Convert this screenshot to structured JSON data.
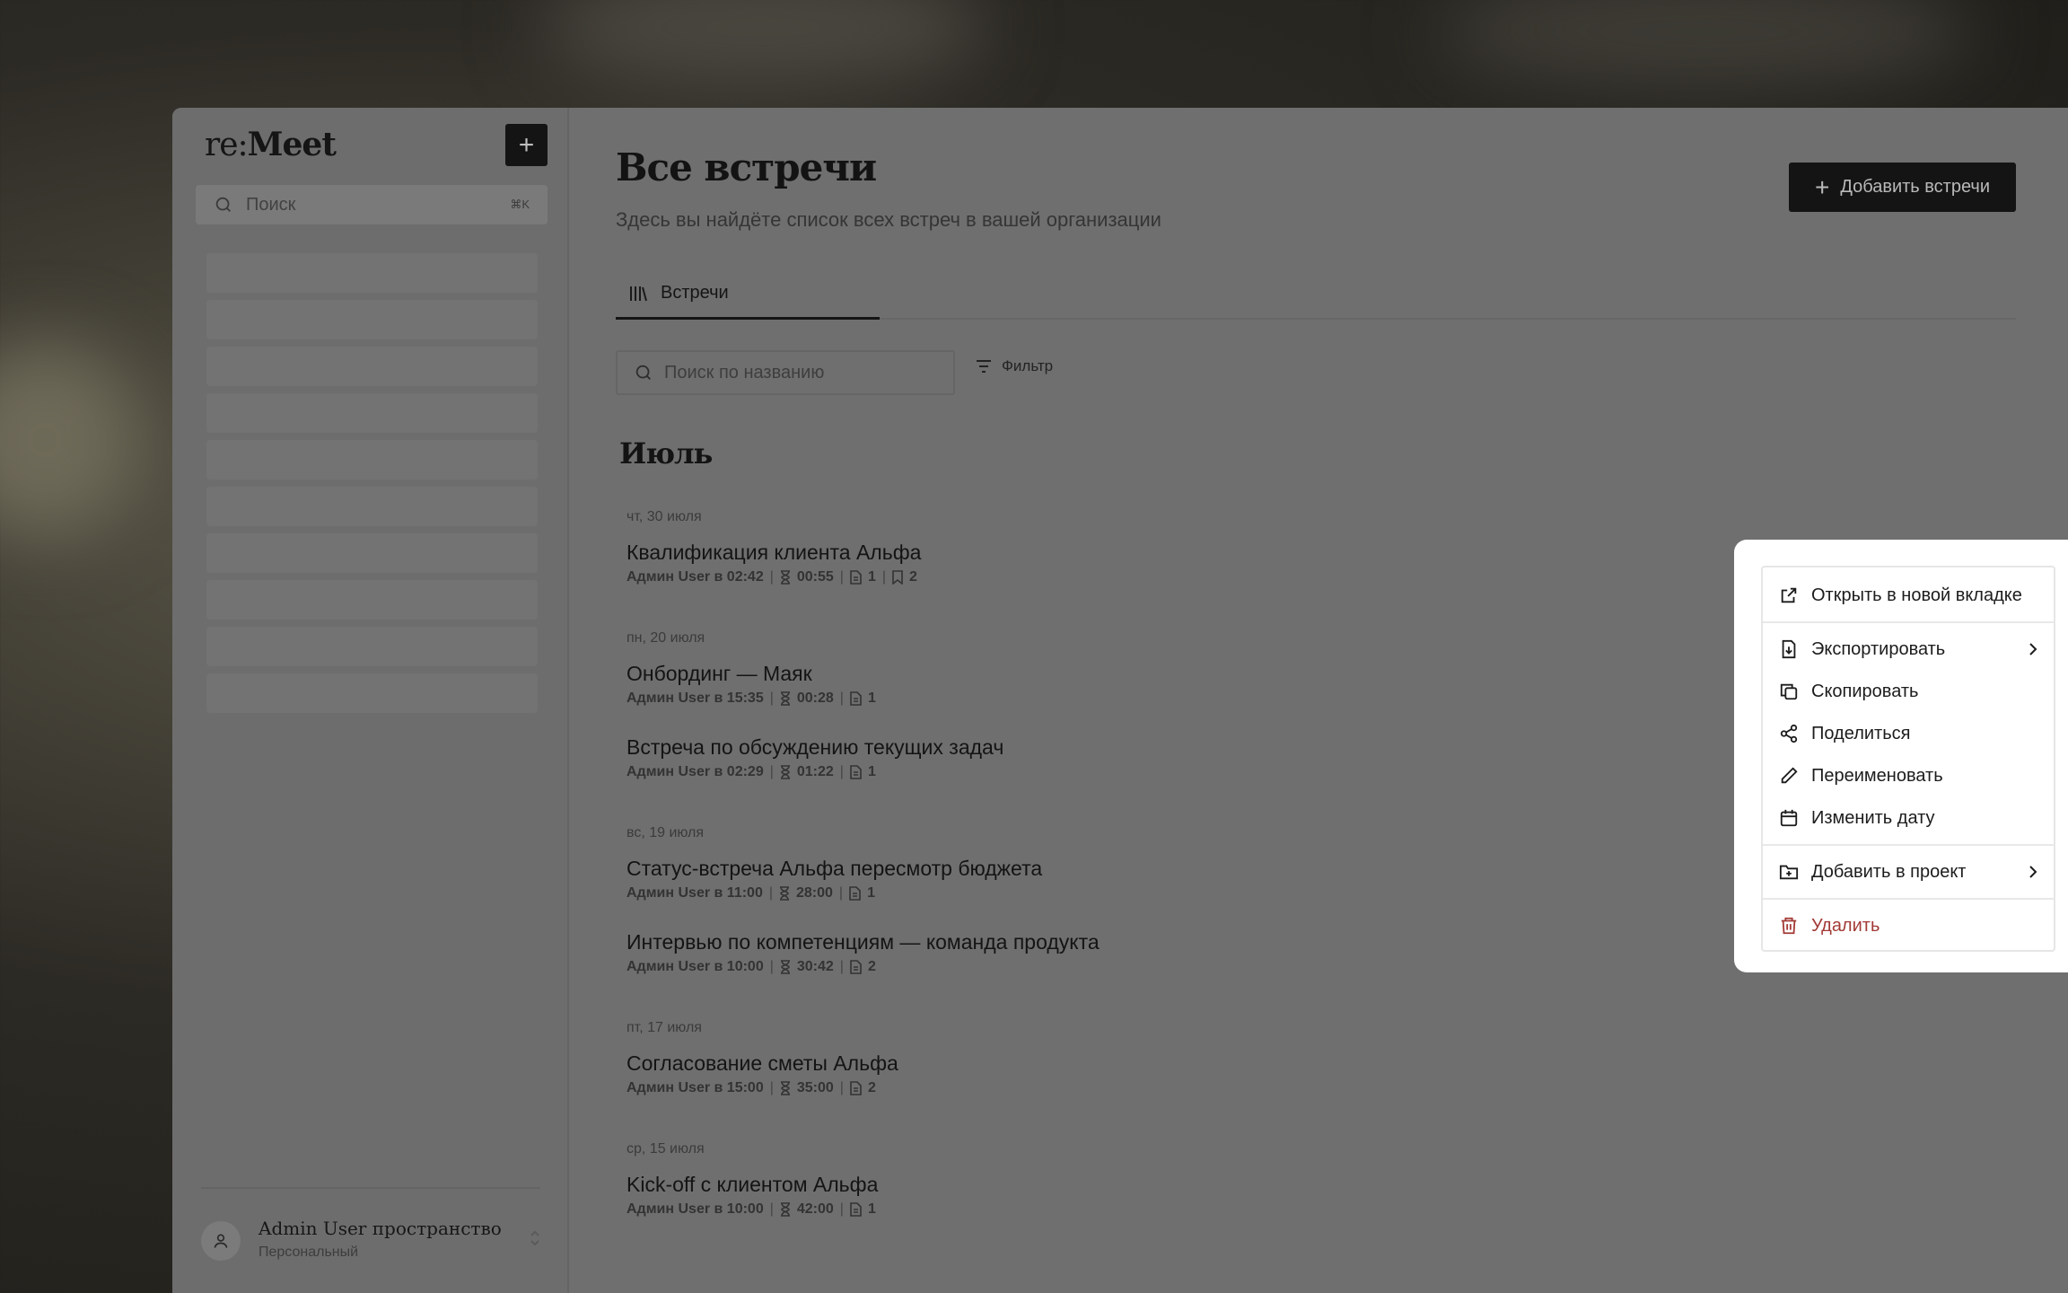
{
  "app": {
    "logo_prefix": "re:",
    "logo_name": "Meet"
  },
  "sidebar": {
    "search_placeholder": "Поиск",
    "search_shortcut": "⌘K",
    "workspace_name": "Admin User пространство",
    "workspace_type": "Персональный"
  },
  "header": {
    "title": "Все встречи",
    "subtitle": "Здесь вы найдёте список всех встреч в вашей организации",
    "add_button": "Добавить встречи"
  },
  "tabs": [
    {
      "label": "Встречи"
    }
  ],
  "toolbar": {
    "search_placeholder": "Поиск по названию",
    "filter_label": "Фильтр"
  },
  "month": "Июль",
  "days": [
    {
      "label": "чт, 30 июля"
    },
    {
      "label": "пн, 20 июля"
    },
    {
      "label": "вс, 19 июля"
    },
    {
      "label": "пт, 17 июля"
    },
    {
      "label": "ср, 15 июля"
    }
  ],
  "meetings": [
    {
      "title": "Квалификация клиента Альфа",
      "author_time": "Админ User в 02:42",
      "duration": "00:55",
      "docs": "1",
      "bookmarks": "2"
    },
    {
      "title": "Онбординг — Маяк",
      "author_time": "Админ User в 15:35",
      "duration": "00:28",
      "docs": "1"
    },
    {
      "title": "Встреча по обсуждению текущих задач",
      "author_time": "Админ User в 02:29",
      "duration": "01:22",
      "docs": "1"
    },
    {
      "title": "Статус-встреча Альфа пересмотр бюджета",
      "author_time": "Админ User в 11:00",
      "duration": "28:00",
      "docs": "1"
    },
    {
      "title": "Интервью по компетенциям — команда продукта",
      "author_time": "Админ User в 10:00",
      "duration": "30:42",
      "docs": "2"
    },
    {
      "title": "Согласование сметы Альфа",
      "author_time": "Админ User в 15:00",
      "duration": "35:00",
      "docs": "2"
    },
    {
      "title": "Kick-off с клиентом Альфа",
      "author_time": "Админ User в 10:00",
      "duration": "42:00",
      "docs": "1"
    }
  ],
  "context_menu": {
    "open_new_tab": "Открыть в новой вкладке",
    "export": "Экспортировать",
    "copy": "Скопировать",
    "share": "Поделиться",
    "rename": "Переименовать",
    "change_date": "Изменить дату",
    "add_to_project": "Добавить в проект",
    "delete": "Удалить",
    "danger_color": "#a33a36"
  }
}
